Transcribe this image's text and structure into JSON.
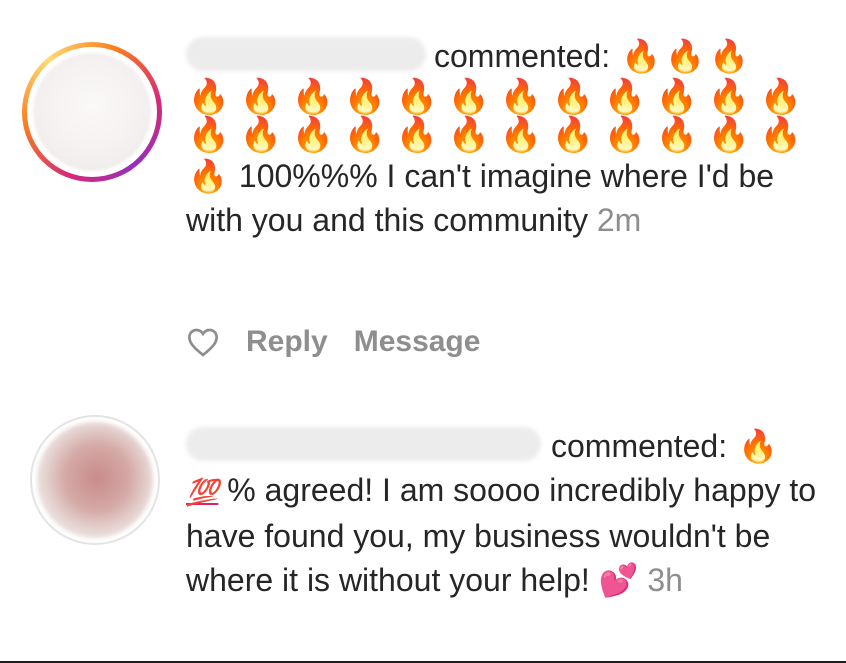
{
  "comments": [
    {
      "username": "",
      "action_label": "commented:",
      "lead_emojis": [
        "🔥",
        "🔥",
        "🔥"
      ],
      "fire_rows": [
        [
          "🔥",
          "🔥",
          "🔥",
          "🔥",
          "🔥",
          "🔥",
          "🔥",
          "🔥",
          "🔥",
          "🔥",
          "🔥",
          "🔥"
        ],
        [
          "🔥",
          "🔥",
          "🔥",
          "🔥",
          "🔥",
          "🔥",
          "🔥",
          "🔥",
          "🔥",
          "🔥",
          "🔥",
          "🔥"
        ]
      ],
      "body_lead_emoji": "🔥",
      "body": "100%%% I can't imagine where I'd be with you and this community",
      "time": "2m",
      "actions": {
        "reply_label": "Reply",
        "message_label": "Message"
      }
    },
    {
      "username": "",
      "action_label": "commented:",
      "lead_emojis": [
        "🔥"
      ],
      "body_lead_emoji": "💯",
      "body": "% agreed! I am soooo incredibly happy to have found you, my business wouldn't be where it is without your help!",
      "trail_emoji": "💕",
      "time": "3h"
    }
  ]
}
